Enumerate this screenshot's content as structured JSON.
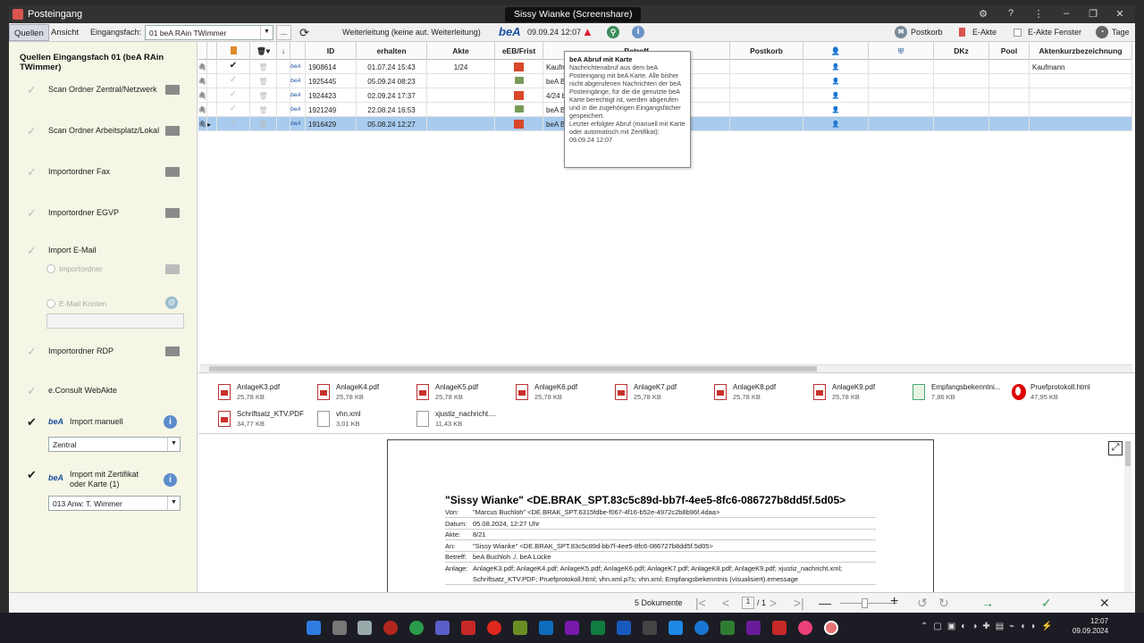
{
  "window": {
    "title": "Posteingang",
    "screenshare": "Sissy Wianke (Screenshare)"
  },
  "toolbar": {
    "tab_quellen": "Quellen",
    "tab_ansicht": "Ansicht",
    "eingangsfach_label": "Eingangsfach:",
    "eingangsfach_value": "01      beA RAin TWimmer",
    "ellipsis": "...",
    "weiterleitung": "Weiterleitung  (keine aut. Weiterleitung)",
    "bea_logo": "beA",
    "bea_datetime": "09.09.24 12:07",
    "postkorb": "Postkorb",
    "eakte": "E-Akte",
    "eakte_fenster": "E-Akte Fenster",
    "tage": "Tage"
  },
  "left": {
    "heading": "Quellen Eingangsfach 01 (beA RAin TWimmer)",
    "sources": [
      {
        "label": "Scan Ordner Zentral/Netzwerk"
      },
      {
        "label": "Scan Ordner Arbeitsplatz/Lokal"
      },
      {
        "label": "Importordner Fax"
      },
      {
        "label": "Importordner EGVP"
      },
      {
        "label": "Import E-Mail"
      },
      {
        "label": "Importordner RDP"
      },
      {
        "label": "e.Consult WebAkte"
      },
      {
        "label": "Import manuell"
      },
      {
        "label": "Import mit Zertifikat oder Karte (1)"
      }
    ],
    "radio_importordner": "Importordner",
    "radio_email_konten": "E-Mail Konten",
    "bea_small": "beA",
    "select_zentral": "Zentral",
    "select_anw": "013 Anw: T. Wimmer"
  },
  "grid": {
    "columns": [
      "ID",
      "erhalten",
      "Akte",
      "eEB/Frist",
      "Betreff",
      "Postkorb",
      "DKz",
      "Pool",
      "Aktenkurzbezeichnung"
    ],
    "bea_tag": "beA",
    "rows": [
      {
        "id": "1908614",
        "erhalten": "01.07.24 15:43",
        "akte": "1/24",
        "betreff": "Kaufman",
        "akten": "Kaufmann"
      },
      {
        "id": "1925445",
        "erhalten": "05.09.24 08:23",
        "akte": "",
        "betreff": "beA Buch",
        "akten": ""
      },
      {
        "id": "1924423",
        "erhalten": "02.09.24 17:37",
        "akte": "",
        "betreff": "4/24 beA",
        "akten": ""
      },
      {
        "id": "1921249",
        "erhalten": "22.08.24 16:53",
        "akte": "",
        "betreff": "beA Buch",
        "akten": ""
      },
      {
        "id": "1916429",
        "erhalten": "05.08.24 12:27",
        "akte": "",
        "betreff": "beA Buc",
        "akten": ""
      }
    ]
  },
  "tooltip": {
    "title": "beA Abruf mit Karte",
    "body": "Nachrichtenabruf aus dem beA Posteingang mit beA Karte. Alle bisher nicht abgerufenen Nachrichten der beA Posteingänge, für die die genutzte beA Karte berechtigt ist, werden abgerufen und in die zugehörigen Eingangsfächer gespeichert.",
    "footer": "Letzter erfolgter Abruf (manuell mit Karte oder automatisch mit Zertifikat): 09.09.24 12:07"
  },
  "attachments": [
    {
      "name": "AnlageK3.pdf",
      "size": "25,78 KB",
      "type": "pdf"
    },
    {
      "name": "AnlageK4.pdf",
      "size": "25,78 KB",
      "type": "pdf"
    },
    {
      "name": "AnlageK5.pdf",
      "size": "25,78 KB",
      "type": "pdf"
    },
    {
      "name": "AnlageK6.pdf",
      "size": "25,78 KB",
      "type": "pdf"
    },
    {
      "name": "AnlageK7.pdf",
      "size": "25,78 KB",
      "type": "pdf"
    },
    {
      "name": "AnlageK8.pdf",
      "size": "25,78 KB",
      "type": "pdf"
    },
    {
      "name": "AnlageK9.pdf",
      "size": "25,78 KB",
      "type": "pdf"
    },
    {
      "name": "Empfangsbekenntni...",
      "size": "7,86 KB",
      "type": "zip"
    },
    {
      "name": "Pruefprotokoll.html",
      "size": "47,95 KB",
      "type": "opera"
    },
    {
      "name": "Schriftsatz_KTV.PDF",
      "size": "34,77 KB",
      "type": "pdf"
    },
    {
      "name": "vhn.xml",
      "size": "3,01 KB",
      "type": "plain"
    },
    {
      "name": "xjustiz_nachricht....",
      "size": "11,43 KB",
      "type": "plain"
    }
  ],
  "preview": {
    "heading": "\"Sissy Wianke\" <DE.BRAK_SPT.83c5c89d-bb7f-4ee5-8fc6-086727b8dd5f.5d05>",
    "rows": [
      {
        "k": "Von:",
        "v": "\"Marcus Buchloh\" <DE.BRAK_SPT.6315fdbe-f067-4f16-b52e-4972c2b8b96f.4daa>"
      },
      {
        "k": "Datum:",
        "v": "05.08.2024, 12:27 Uhr"
      },
      {
        "k": "Akte:",
        "v": "8/21"
      },
      {
        "k": "An:",
        "v": "\"Sissy Wianke\" <DE.BRAK_SPT.83c5c89d-bb7f-4ee5-8fc6-086727b8dd5f.5d05>"
      },
      {
        "k": "Betreff:",
        "v": "beA Buchloh ./. beA Lücke"
      },
      {
        "k": "Anlage:",
        "v": "AnlageK3.pdf; AnlageK4.pdf; AnlageK5.pdf; AnlageK6.pdf; AnlageK7.pdf; AnlageK8.pdf; AnlageK9.pdf; xjustiz_nachricht.xml;"
      },
      {
        "k": "",
        "v": "Schriftsatz_KTV.PDF; Pruefprotokoll.html; vhn.xml.p7s; vhn.xml; Empfangsbekenntnis (visualisiert).emessage"
      }
    ]
  },
  "status": {
    "documents": "5  Dokumente",
    "page_current": "1",
    "page_total": "/ 1"
  },
  "taskbar": {
    "time": "12:07",
    "date": "09.09.2024"
  }
}
